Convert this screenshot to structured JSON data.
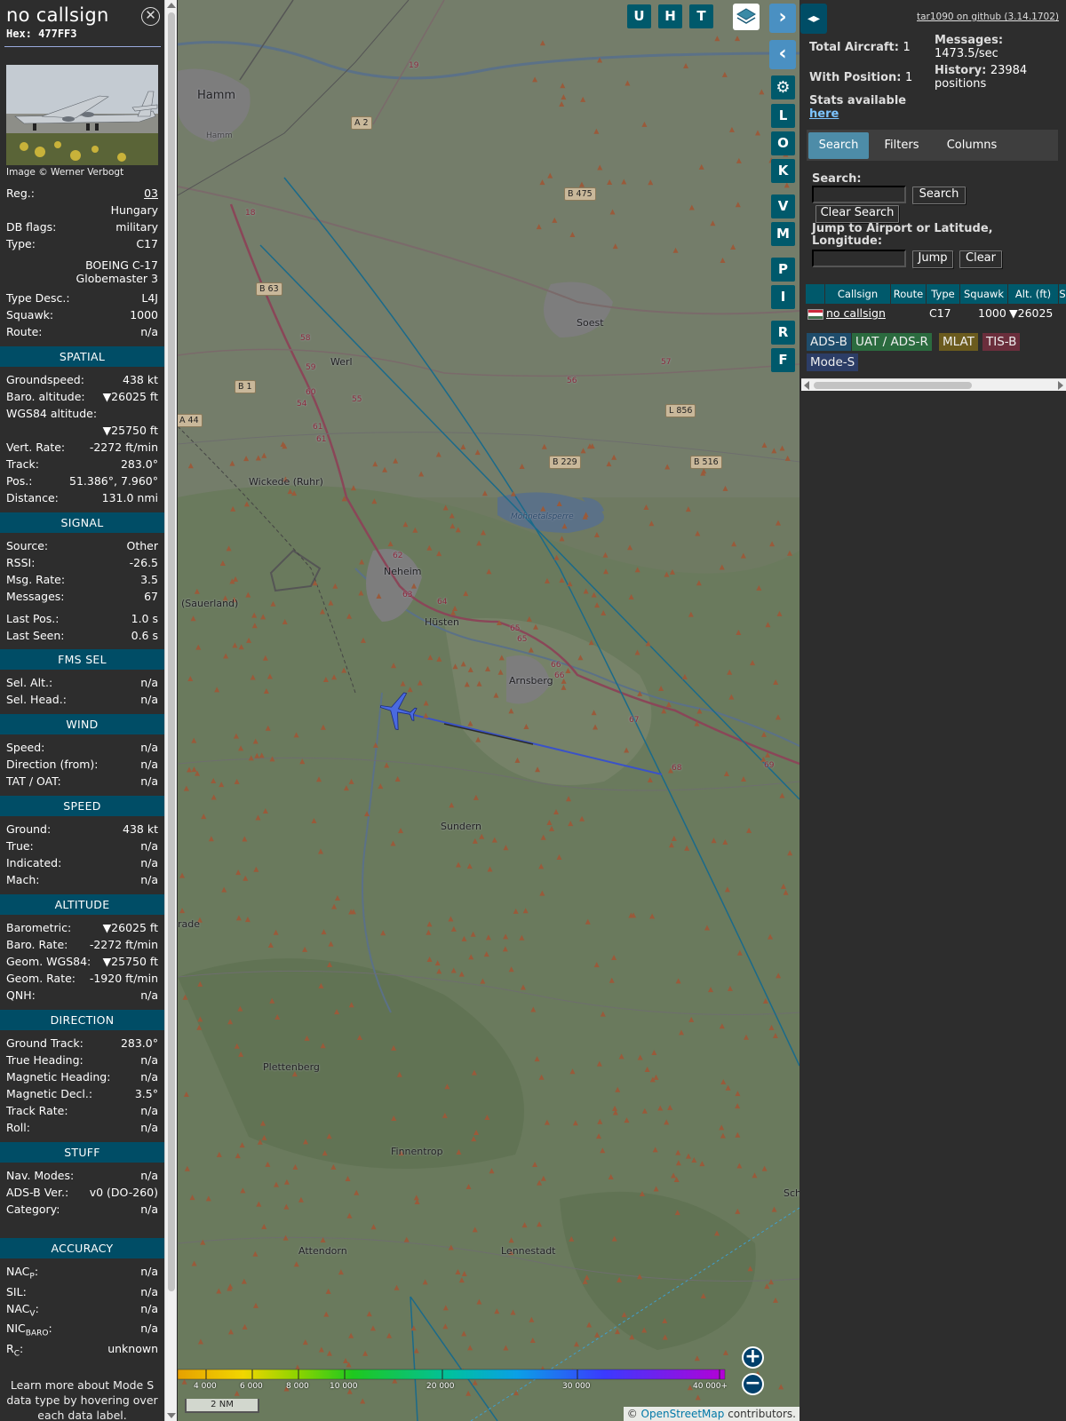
{
  "info": {
    "callsign": "no callsign",
    "hex_label": "Hex:",
    "hex": "477FF3",
    "close_icon": "close-icon",
    "image_credit": "Image © Werner Verbogt",
    "reg_label": "Reg.:",
    "reg": "03",
    "country": "Hungary",
    "dbflags_label": "DB flags:",
    "dbflags": "military",
    "type_label": "Type:",
    "type": "C17",
    "type_full_1": "BOEING C-17",
    "type_full_2": "Globemaster 3",
    "typedesc_label": "Type Desc.:",
    "typedesc": "L4J",
    "squawk_label": "Squawk:",
    "squawk": "1000",
    "route_label": "Route:",
    "route": "n/a",
    "sections": {
      "spatial": "SPATIAL",
      "signal": "SIGNAL",
      "fms": "FMS SEL",
      "wind": "WIND",
      "speed": "SPEED",
      "altitude": "ALTITUDE",
      "direction": "DIRECTION",
      "stuff": "STUFF",
      "accuracy": "ACCURACY"
    },
    "spatial": {
      "gs_label": "Groundspeed:",
      "gs": "438 kt",
      "baro_label": "Baro. altitude:",
      "baro": "▼26025 ft",
      "wgs_label": "WGS84 altitude:",
      "wgs": "▼25750 ft",
      "vr_label": "Vert. Rate:",
      "vr": "-2272 ft/min",
      "track_label": "Track:",
      "track": "283.0°",
      "pos_label": "Pos.:",
      "pos": "51.386°, 7.960°",
      "dist_label": "Distance:",
      "dist": "131.0 nmi"
    },
    "signal": {
      "source_label": "Source:",
      "source": "Other",
      "rssi_label": "RSSI:",
      "rssi": "-26.5",
      "msgrate_label": "Msg. Rate:",
      "msgrate": "3.5",
      "messages_label": "Messages:",
      "messages": "67",
      "lastpos_label": "Last Pos.:",
      "lastpos": "1.0 s",
      "lastseen_label": "Last Seen:",
      "lastseen": "0.6 s"
    },
    "fms": {
      "selalt_label": "Sel. Alt.:",
      "selalt": "n/a",
      "selhead_label": "Sel. Head.:",
      "selhead": "n/a"
    },
    "wind": {
      "speed_label": "Speed:",
      "speed": "n/a",
      "dir_label": "Direction (from):",
      "dir": "n/a",
      "tat_label": "TAT / OAT:",
      "tat": "n/a"
    },
    "speed": {
      "ground_label": "Ground:",
      "ground": "438 kt",
      "true_label": "True:",
      "true": "n/a",
      "ind_label": "Indicated:",
      "ind": "n/a",
      "mach_label": "Mach:",
      "mach": "n/a"
    },
    "altitude": {
      "baro_label": "Barometric:",
      "baro": "▼26025 ft",
      "barorate_label": "Baro. Rate:",
      "barorate": "-2272 ft/min",
      "geom_label": "Geom. WGS84:",
      "geom": "▼25750 ft",
      "geomrate_label": "Geom. Rate:",
      "geomrate": "-1920 ft/min",
      "qnh_label": "QNH:",
      "qnh": "n/a"
    },
    "direction": {
      "gtrack_label": "Ground Track:",
      "gtrack": "283.0°",
      "theading_label": "True Heading:",
      "theading": "n/a",
      "mheading_label": "Magnetic Heading:",
      "mheading": "n/a",
      "mdecl_label": "Magnetic Decl.:",
      "mdecl": "3.5°",
      "trate_label": "Track Rate:",
      "trate": "n/a",
      "roll_label": "Roll:",
      "roll": "n/a"
    },
    "stuff": {
      "nav_label": "Nav. Modes:",
      "nav": "n/a",
      "adsb_label": "ADS-B Ver.:",
      "adsb": "v0 (DO-260)",
      "cat_label": "Category:",
      "cat": "n/a"
    },
    "accuracy": {
      "nacp_label": "NAC",
      "nacp_sub": "P",
      "nacp": "n/a",
      "sil_label": "SIL:",
      "sil": "n/a",
      "nacv_label": "NAC",
      "nacv_sub": "V",
      "nacv": "n/a",
      "nicbaro_label": "NIC",
      "nicbaro_sub": "BARO",
      "nicbaro": "n/a",
      "rc_label": "R",
      "rc_sub": "C",
      "rc": "unknown"
    },
    "learn_more": "Learn more about Mode S data type by hovering over each data label."
  },
  "map": {
    "places": {
      "hamm": "Hamm",
      "hamm_small": "Hamm",
      "soest": "Soest",
      "werl": "Werl",
      "wickede": "Wickede (Ruhr)",
      "neheim": "Neheim",
      "husten": "Hüsten",
      "arnsberg": "Arnsberg",
      "sauerland": "(Sauerland)",
      "sundern": "Sundern",
      "rade": "rade",
      "plettenberg": "Plettenberg",
      "finnentrop": "Finnentrop",
      "attendorn": "Attendorn",
      "lennestadt": "Lennestadt",
      "schm": "Sch",
      "mohne": "Möhnetalsperre"
    },
    "roads": {
      "a2": "A 2",
      "b475": "B 475",
      "b63": "B 63",
      "b1": "B 1",
      "a44": "A 44",
      "b229": "B 229",
      "l856": "L 856",
      "b516": "B 516"
    },
    "exits": [
      "19",
      "18",
      "58",
      "59",
      "60",
      "54",
      "55",
      "61",
      "61",
      "56",
      "57",
      "62",
      "63",
      "64",
      "65",
      "65",
      "66",
      "66",
      "67",
      "68",
      "69"
    ],
    "buttons": {
      "u": "U",
      "h": "H",
      "t": "T",
      "l": "L",
      "o": "O",
      "k": "K",
      "v": "V",
      "m": "M",
      "p": "P",
      "i": "I",
      "r": "R",
      "f": "F",
      "next": "›",
      "prev": "‹",
      "zoom_in": "+",
      "zoom_out": "−"
    },
    "icons": {
      "layers": "layers-icon",
      "settings": "gear-icon",
      "aircraft": "aircraft-icon"
    },
    "scale": "2 NM",
    "attribution_prefix": "© ",
    "attribution_link": "OpenStreetMap",
    "attribution_suffix": " contributors.",
    "altitude_legend": [
      "4 000",
      "6 000",
      "8 000",
      "10 000",
      "20 000",
      "30 000",
      "40 000+"
    ]
  },
  "side": {
    "expand_icon": "◂▸",
    "github_link": "tar1090 on github (3.14.1702)",
    "total_label": "Total Aircraft:",
    "total": "1",
    "position_label": "With Position:",
    "position": "1",
    "messages_label": "Messages:",
    "messages": "1473.5/sec",
    "history_label": "History:",
    "history": "23984",
    "history_unit": "positions",
    "stats_label": "Stats available",
    "stats_link": "here",
    "tabs": [
      "Search",
      "Filters",
      "Columns"
    ],
    "search_label": "Search:",
    "search_button": "Search",
    "clear_search_button": "Clear Search",
    "jump_label": "Jump to Airport or Latitude, Longitude:",
    "jump_button": "Jump",
    "clear_button": "Clear",
    "table_headers": [
      "Callsign",
      "Route",
      "Type",
      "Squawk",
      "Alt. (ft)",
      "S"
    ],
    "table_row": {
      "callsign": "no callsign",
      "type": "C17",
      "squawk": "1000",
      "alt": "▼26025"
    },
    "flag_colors": [
      "#cd2a3e",
      "#ffffff",
      "#436f4d"
    ],
    "legend": [
      {
        "label": "ADS-B",
        "color": "#1e4c6b"
      },
      {
        "label": "UAT / ADS-R",
        "color": "#2b6b3f"
      },
      {
        "label": "MLAT",
        "color": "#6b5b1e"
      },
      {
        "label": "TIS-B",
        "color": "#6b2e3c"
      },
      {
        "label": "Mode-S",
        "color": "#2c3d66"
      }
    ]
  }
}
